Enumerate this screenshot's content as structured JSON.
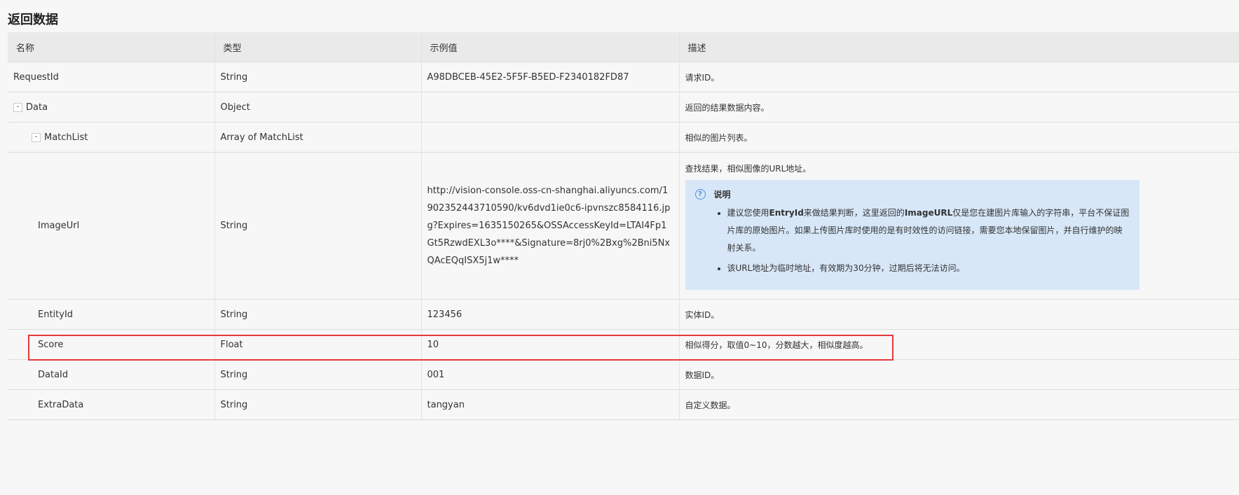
{
  "section": {
    "title": "返回数据"
  },
  "columns": {
    "name": "名称",
    "type": "类型",
    "example": "示例值",
    "description": "描述"
  },
  "rows": {
    "request_id": {
      "name": "RequestId",
      "type": "String",
      "example": "A98DBCEB-45E2-5F5F-B5ED-F2340182FD87",
      "description": "请求ID。"
    },
    "data": {
      "toggle": "-",
      "name": "Data",
      "type": "Object",
      "example": "",
      "description": "返回的结果数据内容。"
    },
    "match_list": {
      "toggle": "-",
      "name": "MatchList",
      "type": "Array of MatchList",
      "example": "",
      "description": "相似的图片列表。"
    },
    "image_url": {
      "name": "ImageUrl",
      "type": "String",
      "example": "http://vision-console.oss-cn-shanghai.aliyuncs.com/1902352443710590/kv6dvd1ie0c6-ipvnszc8584116.jpg?Expires=1635150265&OSSAccessKeyId=LTAI4Fp1Gt5RzwdEXL3o****&Signature=8rj0%2Bxg%2Bni5NxQAcEQqISX5j1w****",
      "description": "查找结果，相似图像的URL地址。",
      "note": {
        "title": "说明",
        "item1_part1": "建议您使用",
        "item1_bold1": "EntryId",
        "item1_part2": "来做结果判断，这里返回的",
        "item1_bold2": "ImageURL",
        "item1_part3": "仅是您在建图片库输入的字符串，平台不保证图片库的原始图片。如果上传图片库时使用的是有时效性的访问链接，需要您本地保留图片，并自行维护的映射关系。",
        "item2": "该URL地址为临时地址，有效期为30分钟，过期后将无法访问。"
      }
    },
    "entity_id": {
      "name": "EntityId",
      "type": "String",
      "example": "123456",
      "description": "实体ID。"
    },
    "score": {
      "name": "Score",
      "type": "Float",
      "example": "10",
      "description": "相似得分，取值0~10，分数越大，相似度越高。"
    },
    "data_id": {
      "name": "DataId",
      "type": "String",
      "example": "001",
      "description": "数据ID。"
    },
    "extra_data": {
      "name": "ExtraData",
      "type": "String",
      "example": "tangyan",
      "description": "自定义数据。"
    }
  },
  "colors": {
    "highlight_border": "#e43a3a",
    "note_background": "#d7e7f8",
    "header_background": "#eaeaea",
    "page_background": "#f7f7f7"
  },
  "icons": {
    "note_icon": "question-circle-icon",
    "collapse_icon": "collapse-toggle-icon"
  }
}
